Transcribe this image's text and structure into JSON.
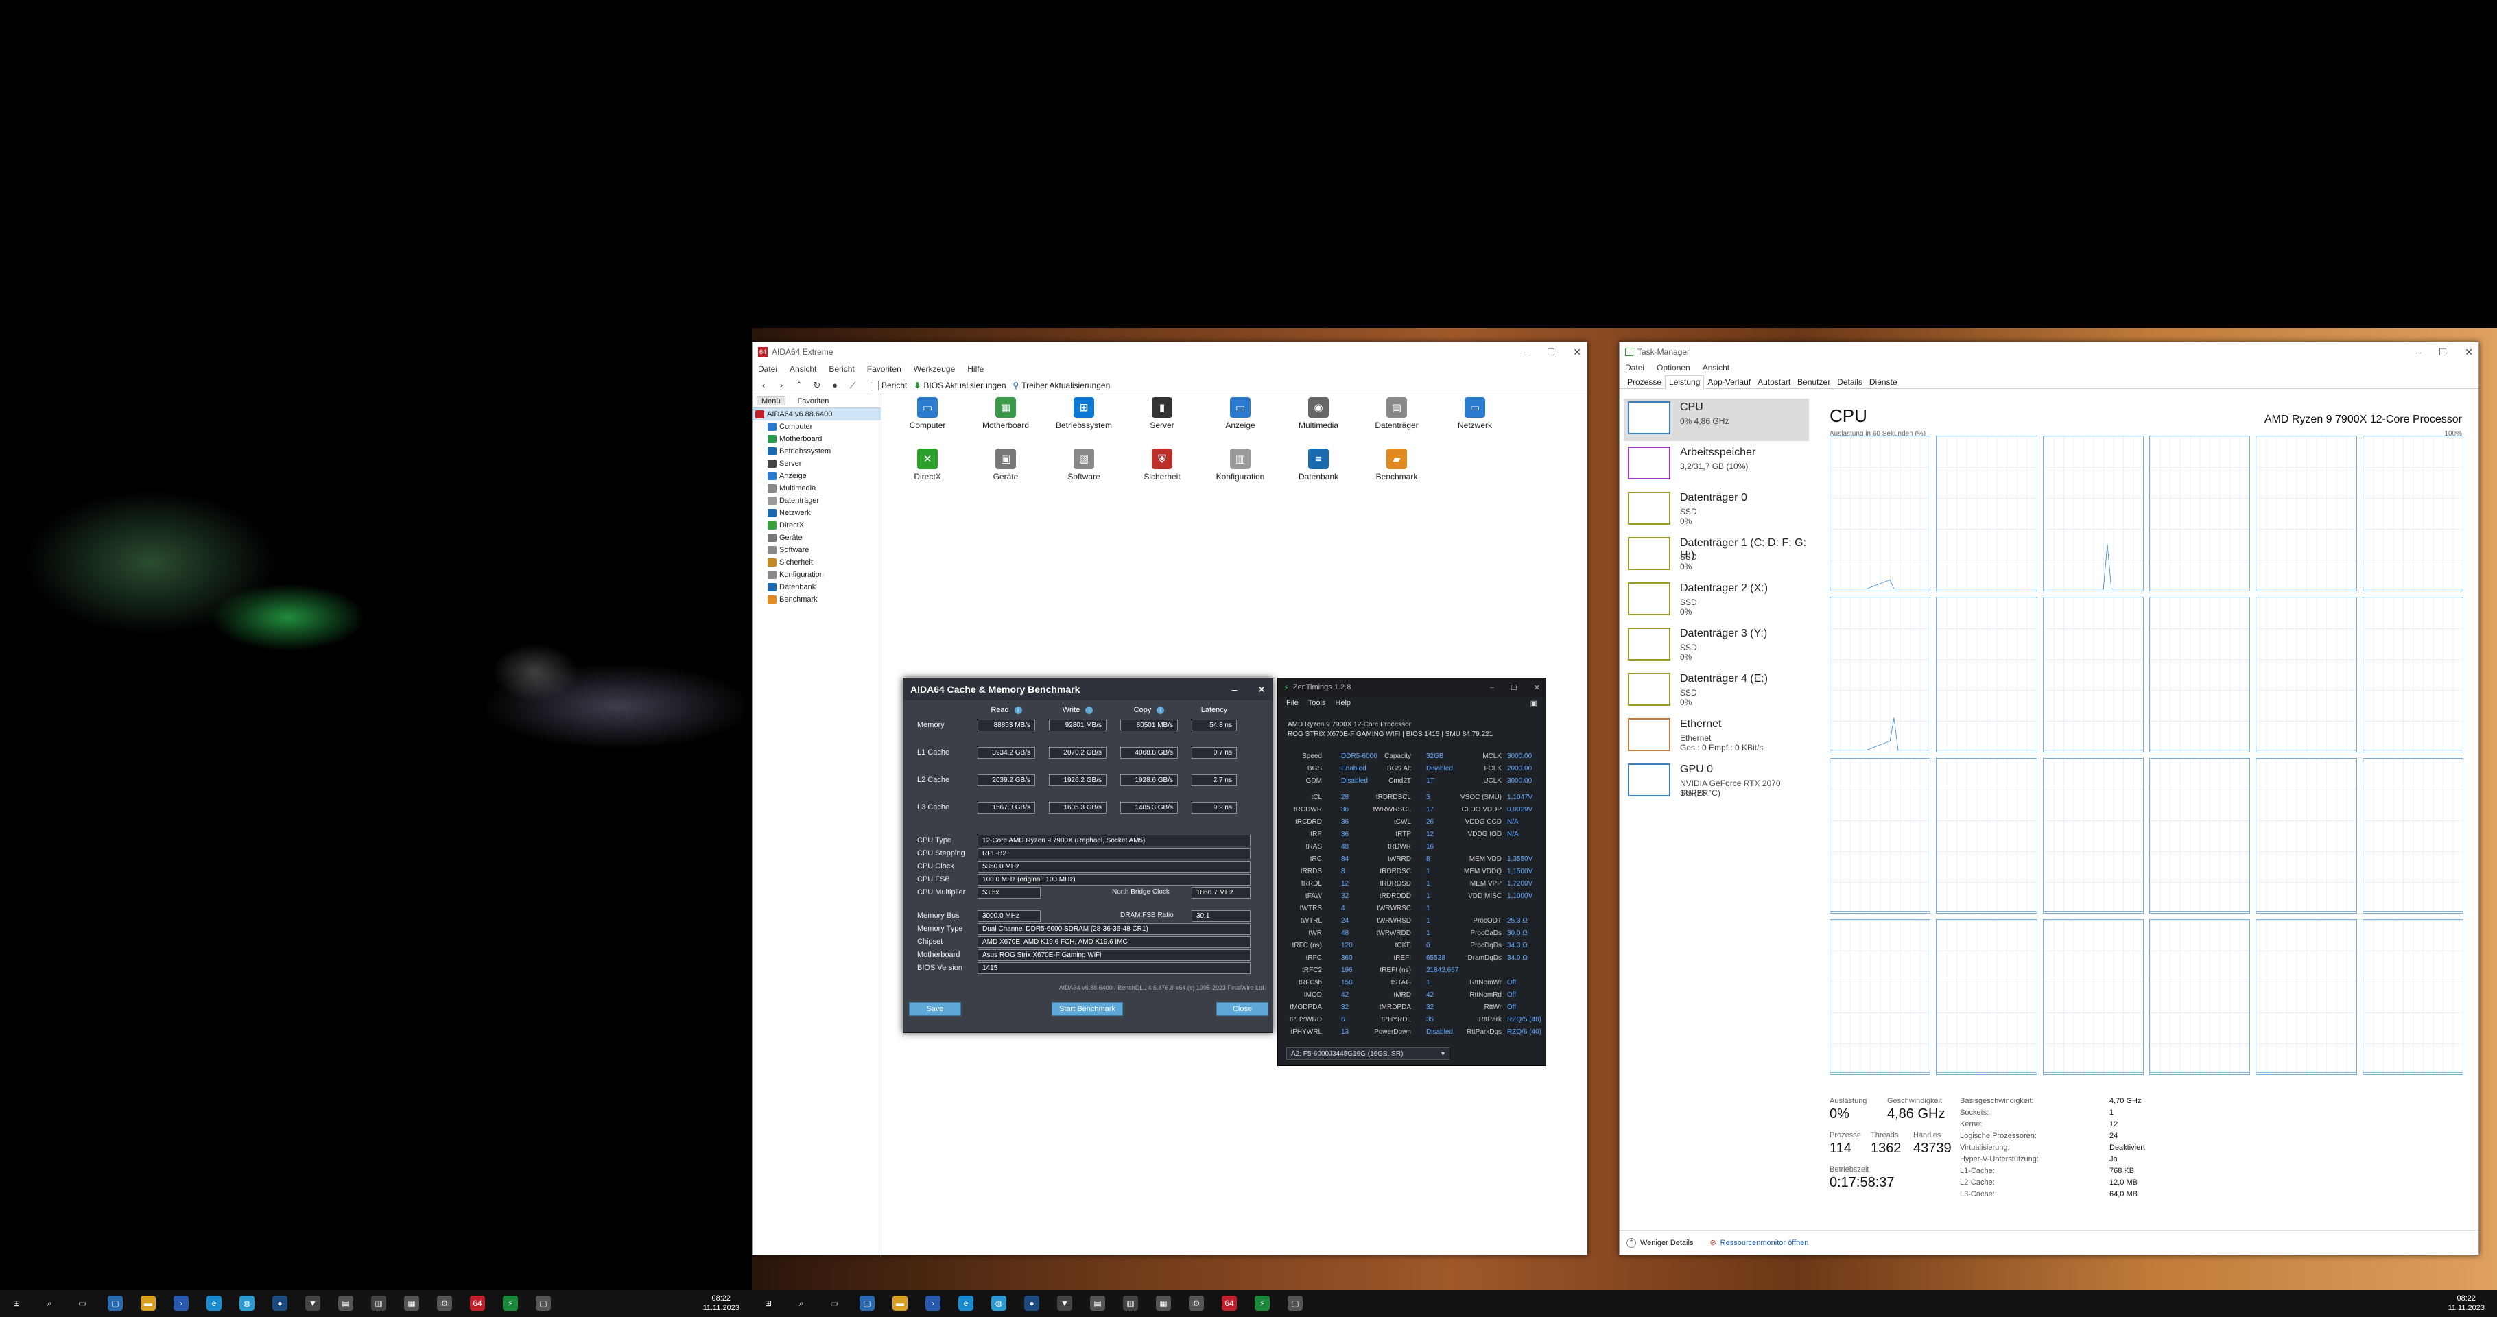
{
  "aida": {
    "title": "AIDA64 Extreme",
    "menu": [
      "Datei",
      "Ansicht",
      "Bericht",
      "Favoriten",
      "Werkzeuge",
      "Hilfe"
    ],
    "toolbar": {
      "report": "Bericht",
      "bios": "BIOS Aktualisierungen",
      "driver": "Treiber Aktualisierungen"
    },
    "tabs": [
      "Menü",
      "Favoriten"
    ],
    "tree_root": "AIDA64 v6.88.6400",
    "tree": [
      "Computer",
      "Motherboard",
      "Betriebssystem",
      "Server",
      "Anzeige",
      "Multimedia",
      "Datenträger",
      "Netzwerk",
      "DirectX",
      "Geräte",
      "Software",
      "Sicherheit",
      "Konfiguration",
      "Datenbank",
      "Benchmark"
    ],
    "icons": [
      "Computer",
      "Motherboard",
      "Betriebssystem",
      "Server",
      "Anzeige",
      "Multimedia",
      "Datenträger",
      "Netzwerk",
      "DirectX",
      "Geräte",
      "Software",
      "Sicherheit",
      "Konfiguration",
      "Datenbank",
      "Benchmark"
    ]
  },
  "bench": {
    "title": "AIDA64 Cache & Memory Benchmark",
    "headers": [
      "Read",
      "Write",
      "Copy",
      "Latency"
    ],
    "rows": [
      {
        "label": "Memory",
        "read": "88853 MB/s",
        "write": "92801 MB/s",
        "copy": "80501 MB/s",
        "lat": "54.8 ns"
      },
      {
        "label": "L1 Cache",
        "read": "3934.2 GB/s",
        "write": "2070.2 GB/s",
        "copy": "4068.8 GB/s",
        "lat": "0.7 ns"
      },
      {
        "label": "L2 Cache",
        "read": "2039.2 GB/s",
        "write": "1926.2 GB/s",
        "copy": "1928.6 GB/s",
        "lat": "2.7 ns"
      },
      {
        "label": "L3 Cache",
        "read": "1567.3 GB/s",
        "write": "1605.3 GB/s",
        "copy": "1485.3 GB/s",
        "lat": "9.9 ns"
      }
    ],
    "info": [
      {
        "label": "CPU Type",
        "value": "12-Core AMD Ryzen 9 7900X  (Raphael, Socket AM5)"
      },
      {
        "label": "CPU Stepping",
        "value": "RPL-B2"
      },
      {
        "label": "CPU Clock",
        "value": "5350.0 MHz"
      },
      {
        "label": "CPU FSB",
        "value": "100.0 MHz  (original: 100 MHz)"
      },
      {
        "label": "CPU Multiplier",
        "value": "53.5x"
      }
    ],
    "nb_label": "North Bridge Clock",
    "nb_value": "1866.7 MHz",
    "mem": [
      {
        "label": "Memory Bus",
        "value": "3000.0 MHz"
      },
      {
        "label": "Memory Type",
        "value": "Dual Channel DDR5-6000 SDRAM  (28-36-36-48 CR1)"
      },
      {
        "label": "Chipset",
        "value": "AMD X670E, AMD K19.6 FCH, AMD K19.6 IMC"
      },
      {
        "label": "Motherboard",
        "value": "Asus ROG Strix X670E-F Gaming WiFi"
      },
      {
        "label": "BIOS Version",
        "value": "1415"
      }
    ],
    "ratio_label": "DRAM:FSB Ratio",
    "ratio_value": "30:1",
    "footer": "AIDA64 v6.88.6400 / BenchDLL 4.6.876.8-x64  (c) 1995-2023 FinalWire Ltd.",
    "buttons": {
      "save": "Save",
      "start": "Start Benchmark",
      "close": "Close"
    }
  },
  "zen": {
    "title": "ZenTimings 1.2.8",
    "menu": [
      "File",
      "Tools",
      "Help"
    ],
    "cpu": "AMD Ryzen 9 7900X 12-Core Processor",
    "board": "ROG STRIX X670E-F GAMING WIFI | BIOS 1415 | SMU 84.79.221",
    "top": [
      {
        "l": "Speed",
        "v": "DDR5-6000",
        "l2": "Capacity",
        "v2": "32GB",
        "l3": "MCLK",
        "v3": "3000.00"
      },
      {
        "l": "BGS",
        "v": "Enabled",
        "l2": "BGS Alt",
        "v2": "Disabled",
        "l3": "FCLK",
        "v3": "2000.00"
      },
      {
        "l": "GDM",
        "v": "Disabled",
        "l2": "Cmd2T",
        "v2": "1T",
        "l3": "UCLK",
        "v3": "3000.00"
      }
    ],
    "timings": [
      {
        "l": "tCL",
        "v": "28",
        "l2": "tRDRDSCL",
        "v2": "3",
        "l3": "VSOC (SMU)",
        "v3": "1,1047V"
      },
      {
        "l": "tRCDWR",
        "v": "36",
        "l2": "tWRWRSCL",
        "v2": "17",
        "l3": "CLDO VDDP",
        "v3": "0,9029V"
      },
      {
        "l": "tRCDRD",
        "v": "36",
        "l2": "tCWL",
        "v2": "26",
        "l3": "VDDG CCD",
        "v3": "N/A"
      },
      {
        "l": "tRP",
        "v": "36",
        "l2": "tRTP",
        "v2": "12",
        "l3": "VDDG IOD",
        "v3": "N/A"
      },
      {
        "l": "tRAS",
        "v": "48",
        "l2": "tRDWR",
        "v2": "16",
        "l3": "",
        "v3": ""
      },
      {
        "l": "tRC",
        "v": "84",
        "l2": "tWRRD",
        "v2": "8",
        "l3": "MEM VDD",
        "v3": "1,3550V"
      },
      {
        "l": "tRRDS",
        "v": "8",
        "l2": "tRDRDSC",
        "v2": "1",
        "l3": "MEM VDDQ",
        "v3": "1,1500V"
      },
      {
        "l": "tRRDL",
        "v": "12",
        "l2": "tRDRDSD",
        "v2": "1",
        "l3": "MEM VPP",
        "v3": "1,7200V"
      },
      {
        "l": "tFAW",
        "v": "32",
        "l2": "tRDRDDD",
        "v2": "1",
        "l3": "VDD MISC",
        "v3": "1,1000V"
      },
      {
        "l": "tWTRS",
        "v": "4",
        "l2": "tWRWRSC",
        "v2": "1",
        "l3": "",
        "v3": ""
      },
      {
        "l": "tWTRL",
        "v": "24",
        "l2": "tWRWRSD",
        "v2": "1",
        "l3": "ProcODT",
        "v3": "25.3 Ω"
      },
      {
        "l": "tWR",
        "v": "48",
        "l2": "tWRWRDD",
        "v2": "1",
        "l3": "ProcCaDs",
        "v3": "30.0 Ω"
      },
      {
        "l": "tRFC (ns)",
        "v": "120",
        "l2": "tCKE",
        "v2": "0",
        "l3": "ProcDqDs",
        "v3": "34.3 Ω"
      },
      {
        "l": "tRFC",
        "v": "360",
        "l2": "tREFI",
        "v2": "65528",
        "l3": "DramDqDs",
        "v3": "34.0 Ω"
      },
      {
        "l": "tRFC2",
        "v": "196",
        "l2": "tREFI (ns)",
        "v2": "21842,667",
        "l3": "",
        "v3": ""
      },
      {
        "l": "tRFCsb",
        "v": "158",
        "l2": "tSTAG",
        "v2": "1",
        "l3": "RttNomWr",
        "v3": "Off"
      },
      {
        "l": "tMOD",
        "v": "42",
        "l2": "tMRD",
        "v2": "42",
        "l3": "RttNomRd",
        "v3": "Off"
      },
      {
        "l": "tMODPDA",
        "v": "32",
        "l2": "tMRDPDA",
        "v2": "32",
        "l3": "RttWr",
        "v3": "Off"
      },
      {
        "l": "tPHYWRD",
        "v": "6",
        "l2": "tPHYRDL",
        "v2": "35",
        "l3": "RttPark",
        "v3": "RZQ/5 (48)"
      },
      {
        "l": "tPHYWRL",
        "v": "13",
        "l2": "PowerDown",
        "v2": "Disabled",
        "l3": "RttParkDqs",
        "v3": "RZQ/6 (40)"
      }
    ],
    "dimm": "A2: F5-6000J3445G16G (16GB, SR)"
  },
  "tm": {
    "title": "Task-Manager",
    "menu": [
      "Datei",
      "Optionen",
      "Ansicht"
    ],
    "tabs": [
      "Prozesse",
      "Leistung",
      "App-Verlauf",
      "Autostart",
      "Benutzer",
      "Details",
      "Dienste"
    ],
    "side": [
      {
        "t": "CPU",
        "s": "0%  4,86 GHz",
        "s2": ""
      },
      {
        "t": "Arbeitsspeicher",
        "s": "3,2/31,7 GB (10%)",
        "s2": ""
      },
      {
        "t": "Datenträger 0",
        "s": "SSD",
        "s2": "0%"
      },
      {
        "t": "Datenträger 1 (C: D: F: G: H:)",
        "s": "SSD",
        "s2": "0%"
      },
      {
        "t": "Datenträger 2 (X:)",
        "s": "SSD",
        "s2": "0%"
      },
      {
        "t": "Datenträger 3 (Y:)",
        "s": "SSD",
        "s2": "0%"
      },
      {
        "t": "Datenträger 4 (E:)",
        "s": "SSD",
        "s2": "0%"
      },
      {
        "t": "Ethernet",
        "s": "Ethernet",
        "s2": "Ges.: 0 Empf.: 0 KBit/s"
      },
      {
        "t": "GPU 0",
        "s": "NVIDIA GeForce RTX 2070 SUPER",
        "s2": "1%  (28 °C)"
      }
    ],
    "heading": "CPU",
    "cpu_name": "AMD Ryzen 9 7900X 12-Core Processor",
    "graph_label": "Auslastung in 60 Sekunden (%)",
    "graph_max": "100%",
    "stats": {
      "l_util": "Auslastung",
      "v_util": "0%",
      "l_speed": "Geschwindigkeit",
      "v_speed": "4,86 GHz",
      "l_proc": "Prozesse",
      "v_proc": "114",
      "l_thr": "Threads",
      "v_thr": "1362",
      "l_hnd": "Handles",
      "v_hnd": "43739",
      "l_up": "Betriebszeit",
      "v_up": "0:17:58:37"
    },
    "specs": [
      {
        "l": "Basisgeschwindigkeit:",
        "v": "4,70 GHz"
      },
      {
        "l": "Sockets:",
        "v": "1"
      },
      {
        "l": "Kerne:",
        "v": "12"
      },
      {
        "l": "Logische Prozessoren:",
        "v": "24"
      },
      {
        "l": "Virtualisierung:",
        "v": "Deaktiviert"
      },
      {
        "l": "Hyper-V-Unterstützung:",
        "v": "Ja"
      },
      {
        "l": "L1-Cache:",
        "v": "768 KB"
      },
      {
        "l": "L2-Cache:",
        "v": "12,0 MB"
      },
      {
        "l": "L3-Cache:",
        "v": "64,0 MB"
      }
    ],
    "footer_less": "Weniger Details",
    "footer_res": "Ressourcenmonitor öffnen"
  },
  "taskbar": {
    "time": "08:22",
    "date": "11.11.2023",
    "badge": "64"
  }
}
